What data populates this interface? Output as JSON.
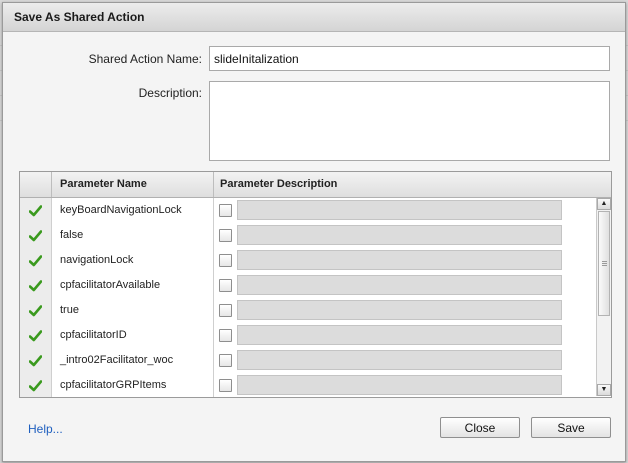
{
  "dialog": {
    "title": "Save As Shared Action"
  },
  "form": {
    "name_label": "Shared Action Name:",
    "name_value": "slideInitalization",
    "description_label": "Description:",
    "description_value": ""
  },
  "table": {
    "col_name": "Parameter Name",
    "col_description": "Parameter Description",
    "rows": [
      {
        "name": "keyBoardNavigationLock"
      },
      {
        "name": "false"
      },
      {
        "name": "navigationLock"
      },
      {
        "name": "cpfacilitatorAvailable"
      },
      {
        "name": "true"
      },
      {
        "name": "cpfacilitatorID"
      },
      {
        "name": "_intro02Facilitator_woc"
      },
      {
        "name": "cpfacilitatorGRPItems"
      }
    ]
  },
  "footer": {
    "help_label": "Help...",
    "close_label": "Close",
    "save_label": "Save"
  },
  "icons": {
    "row_status": "checkmark-icon",
    "checkmark_color": "#3a9a1e"
  }
}
